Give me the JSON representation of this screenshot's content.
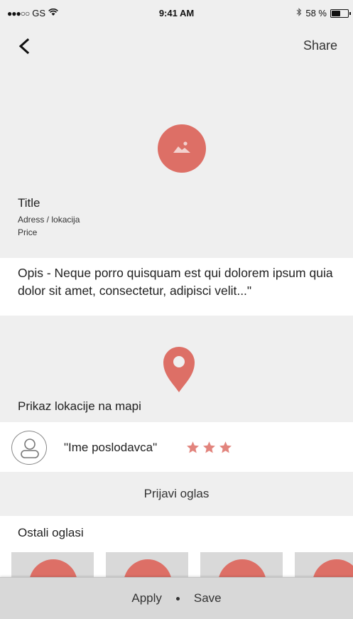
{
  "status_bar": {
    "signal": "●●●○○",
    "carrier": "GS",
    "time": "9:41 AM",
    "battery_text": "58 %",
    "battery_level": 0.58,
    "icons": [
      "wifi-icon",
      "bluetooth-icon",
      "battery-icon"
    ]
  },
  "header": {
    "back_icon": "chevron-left-icon",
    "share_label": "Share"
  },
  "listing": {
    "image_icon": "image-placeholder-icon",
    "title": "Title",
    "address": "Adress / lokacija",
    "price": "Price",
    "description": "Opis - Neque porro quisquam est qui dolorem ipsum quia dolor sit amet, consectetur, adipisci velit...\""
  },
  "map": {
    "pin_icon": "map-pin-icon",
    "label": "Prikaz lokacije na mapi"
  },
  "employer": {
    "avatar_icon": "user-avatar-icon",
    "name": "\"Ime poslodavca\"",
    "rating": 3,
    "rating_max": 3
  },
  "report_label": "Prijavi oglas",
  "other_ads": {
    "heading": "Ostali oglasi",
    "count": 4
  },
  "bottom_bar": {
    "apply_label": "Apply",
    "save_label": "Save"
  },
  "colors": {
    "accent": "#dd6f66",
    "panel_bg": "#efefef",
    "thumb_bg": "#d9d9d9",
    "bottom_bar_bg": "#d8d8d8"
  }
}
